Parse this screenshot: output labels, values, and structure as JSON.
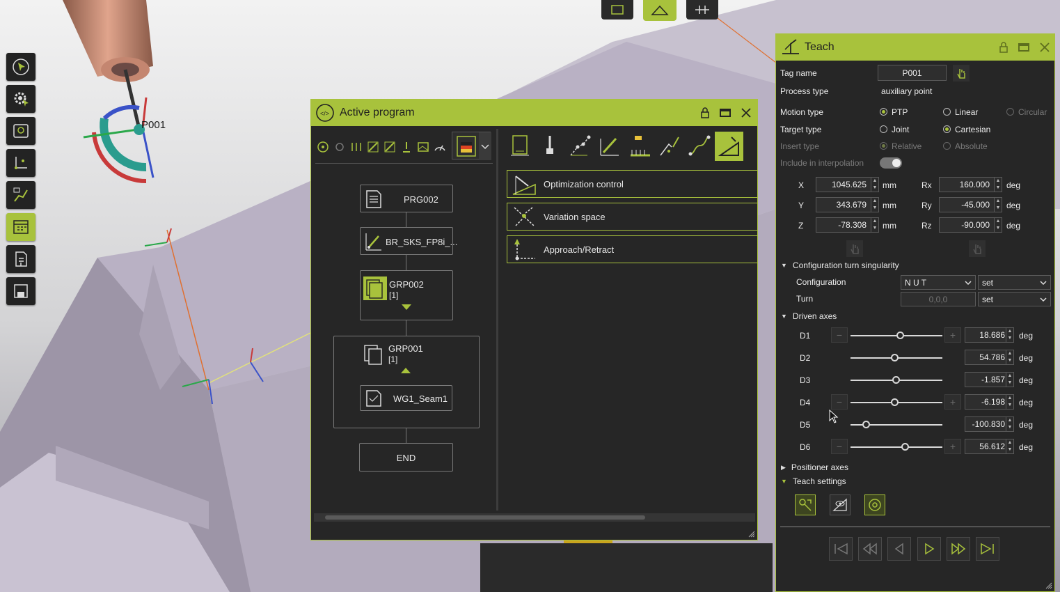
{
  "scene": {
    "point_tag": "P001"
  },
  "left_toolbar": [
    {
      "icon": "select-arrow-icon"
    },
    {
      "icon": "settings-icon"
    },
    {
      "icon": "map-icon"
    },
    {
      "icon": "coordinate-system-icon"
    },
    {
      "icon": "path-icon"
    },
    {
      "icon": "calendar-icon"
    },
    {
      "icon": "document-download-icon"
    },
    {
      "icon": "save-icon"
    }
  ],
  "active_program": {
    "title": "Active program",
    "nodes": {
      "prg": "PRG002",
      "br": "BR_SKS_FP8i_...",
      "grp2": "GRP002",
      "grp2_count": "[1]",
      "grp1": "GRP001",
      "grp1_count": "[1]",
      "seam": "WG1_Seam1",
      "end": "END"
    },
    "options": [
      "Optimization control",
      "Variation space",
      "Approach/Retract"
    ]
  },
  "teach": {
    "title": "Teach",
    "tag_name_label": "Tag name",
    "tag_name_value": "P001",
    "process_type_label": "Process type",
    "process_type_value": "auxiliary point",
    "motion_type_label": "Motion type",
    "motion_ptp": "PTP",
    "motion_linear": "Linear",
    "motion_circular": "Circular",
    "target_type_label": "Target type",
    "target_joint": "Joint",
    "target_cartesian": "Cartesian",
    "insert_type_label": "Insert type",
    "insert_relative": "Relative",
    "insert_absolute": "Absolute",
    "include_label": "Include in interpolation",
    "x_label": "X",
    "x": "1045.625",
    "y_label": "Y",
    "y": "343.679",
    "z_label": "Z",
    "z": "-78.308",
    "rx_label": "Rx",
    "rx": "160.000",
    "ry_label": "Ry",
    "ry": "-45.000",
    "rz_label": "Rz",
    "rz": "-90.000",
    "unit_mm": "mm",
    "unit_deg": "deg",
    "config_section": "Configuration turn singularity",
    "configuration_label": "Configuration",
    "configuration_value": "N U T",
    "configuration_mode": "set",
    "turn_label": "Turn",
    "turn_placeholder": "0,0,0",
    "turn_mode": "set",
    "driven_section": "Driven axes",
    "axes": [
      {
        "name": "D1",
        "value": "18.686",
        "fraction": 0.54
      },
      {
        "name": "D2",
        "value": "54.786",
        "fraction": 0.48
      },
      {
        "name": "D3",
        "value": "-1.857",
        "fraction": 0.49
      },
      {
        "name": "D4",
        "value": "-6.198",
        "fraction": 0.48
      },
      {
        "name": "D5",
        "value": "-100.830",
        "fraction": 0.17
      },
      {
        "name": "D6",
        "value": "56.612",
        "fraction": 0.59
      }
    ],
    "positioner_section": "Positioner axes",
    "teach_settings_section": "Teach settings"
  }
}
